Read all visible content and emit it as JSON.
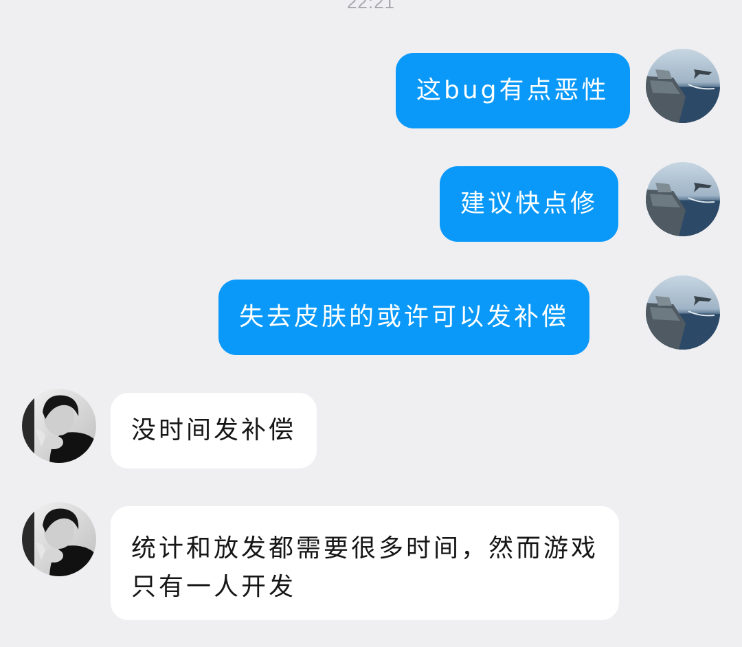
{
  "chat": {
    "timestamp": "22:21",
    "messages": [
      {
        "side": "out",
        "sender": "me",
        "text": "这bug有点恶性"
      },
      {
        "side": "out",
        "sender": "me",
        "text": "建议快点修"
      },
      {
        "side": "out",
        "sender": "me",
        "text": "失去皮肤的或许可以发补偿"
      },
      {
        "side": "in",
        "sender": "developer",
        "text": "没时间发补偿"
      },
      {
        "side": "in",
        "sender": "developer",
        "text": "统计和放发都需要很多时间，然而游戏只有一人开发"
      }
    ]
  },
  "colors": {
    "background": "#efeff2",
    "outgoing_bubble": "#0a99f8",
    "incoming_bubble": "#ffffff",
    "timestamp": "#a9a9ae"
  },
  "icons": {
    "my_avatar": "game-scene-jet-over-ship-avatar",
    "peer_avatar": "grayscale-person-portrait-avatar"
  }
}
